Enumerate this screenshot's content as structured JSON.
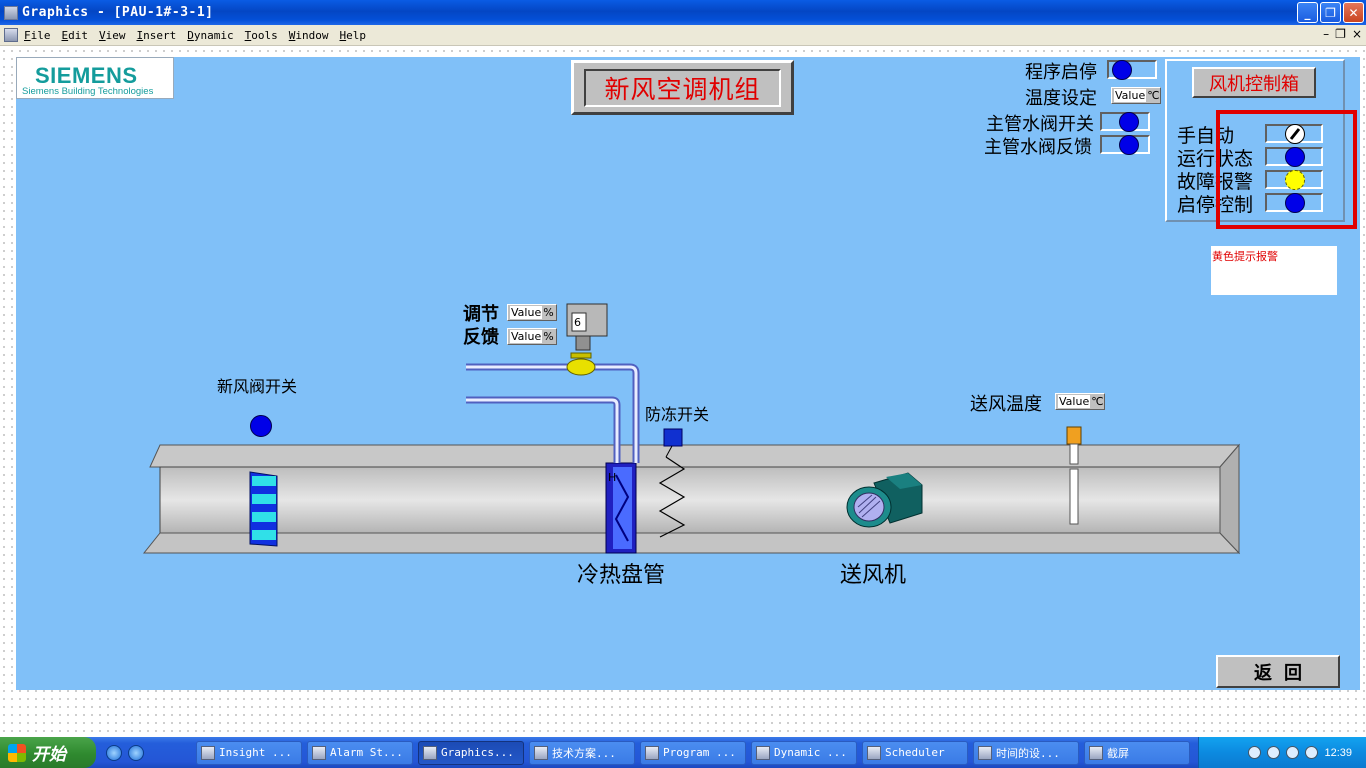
{
  "window": {
    "title": "Graphics - [PAU-1#-3-1]",
    "buttons": {
      "minimize": "_",
      "maximize": "❐",
      "close": "✕"
    }
  },
  "menu": {
    "items": [
      "File",
      "Edit",
      "View",
      "Insert",
      "Dynamic",
      "Tools",
      "Window",
      "Help"
    ],
    "mdi_min": "–",
    "mdi_restore": "❐",
    "mdi_close": "×"
  },
  "logo": {
    "brand": "SIEMENS",
    "subtitle": "Siemens Building Technologies"
  },
  "title": "新风空调机组",
  "status": {
    "program_start_stop": "程序启停",
    "temp_setting": "温度设定",
    "main_valve_switch": "主管水阀开关",
    "main_valve_feedback": "主管水阀反馈"
  },
  "value_box": {
    "value": "Value",
    "unit_c": "℃",
    "unit_pct": "%"
  },
  "fan_panel": {
    "title": "风机控制箱",
    "rows": [
      {
        "label": "手自动",
        "state": "manual-auto"
      },
      {
        "label": "运行状态",
        "state": "blue"
      },
      {
        "label": "故障报警",
        "state": "yellow"
      },
      {
        "label": "启停控制",
        "state": "blue"
      }
    ]
  },
  "note": "黄色提示报警",
  "diagram": {
    "adjust": "调节",
    "feedback": "反馈",
    "fresh_damper": "新风阀开关",
    "freeze_switch": "防冻开关",
    "supply_temp": "送风温度",
    "coil": "冷热盘管",
    "fan": "送风机",
    "valve_display": "6"
  },
  "return_button": "返回",
  "colors": {
    "canvas": "#80c0f8",
    "indicator_blue": "#0000e8",
    "alarm_yellow": "#ffff00",
    "title_red": "#e00000"
  },
  "taskbar": {
    "start": "开始",
    "tasks": [
      "Insight ...",
      "Alarm St...",
      "Graphics...",
      "技术方案...",
      "Program ...",
      "Dynamic ...",
      "Scheduler",
      "时间的设...",
      "截屏"
    ],
    "clock": "12:39"
  }
}
